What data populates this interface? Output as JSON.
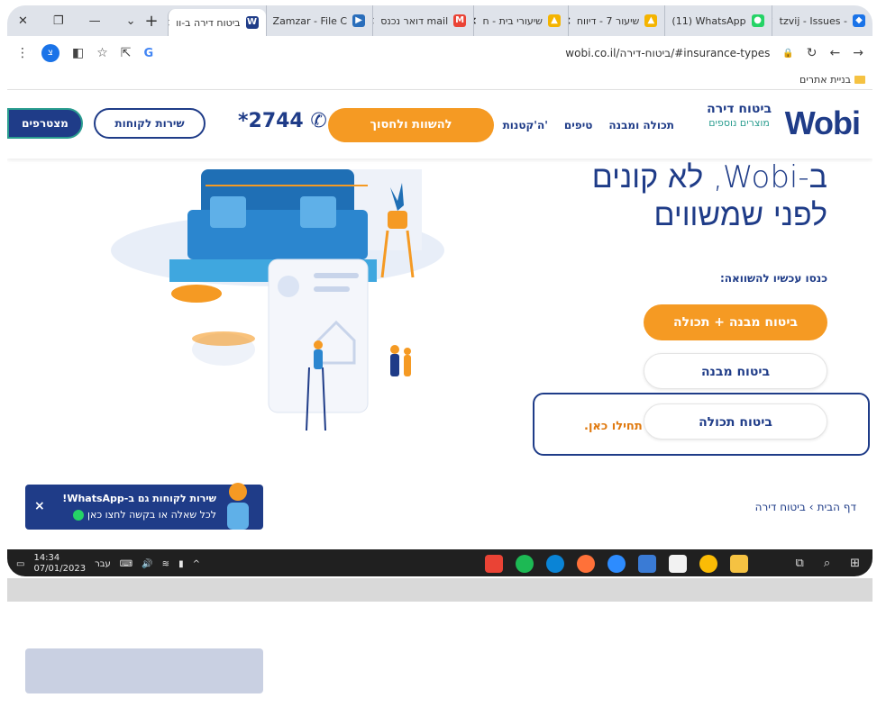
{
  "browser": {
    "tabs": [
      {
        "label": "tzvij - Issues -",
        "favicon_color": "#1a73e8"
      },
      {
        "label": "(11) WhatsApp",
        "favicon_color": "#25d366"
      },
      {
        "label": "שיעור 7 - דיווח",
        "favicon_color": "#f4b400"
      },
      {
        "label": "שיעורי בית - ח",
        "favicon_color": "#f4b400"
      },
      {
        "label": "דואר נכנס mail",
        "favicon_color": "#ea4335"
      },
      {
        "label": "Zamzar - File C",
        "favicon_color": "#2a6ebb"
      },
      {
        "label": "ביטוח דירה ב-וו",
        "favicon_color": "#1f3c88"
      }
    ],
    "url": "wobi.co.il/ביטוח-דירה/#insurance-types",
    "bookmark_folder": "בניית אתרים",
    "profile_badge": "צ"
  },
  "header": {
    "logo": "Wobi",
    "product_title": "ביטוח דירה",
    "product_sub": "מוצרים נוספים",
    "nav": [
      "תכולה ומבנה",
      "טיפים",
      "ה'קטנות'"
    ],
    "compare_cta": "להשוות ולחסוך",
    "phone": "*2744",
    "customer_service": "שירות לקוחות",
    "join": "מצטרפים"
  },
  "hero": {
    "title_line1": "ב-Wobi, לא קונים",
    "title_line2": "לפני שמשווים",
    "compare_label": "כנסו עכשיו להשוואה:",
    "option1": "ביטוח מבנה + תכולה",
    "option2": "ביטוח מבנה",
    "option3": "ביטוח תכולה",
    "start_here": "תחילו כאן."
  },
  "breadcrumb": {
    "home": "דף הבית",
    "separator": "›",
    "current": "ביטוח דירה"
  },
  "whatsapp_banner": {
    "title": "שירות לקוחות גם ב-WhatsApp!",
    "subtitle": "לכל שאלה או בקשה לחצו כאן",
    "close": "×"
  },
  "taskbar": {
    "time": "14:34",
    "date": "07/01/2023",
    "lang": "עבר"
  },
  "colors": {
    "brand_blue": "#1f3c88",
    "brand_orange": "#f59a23",
    "teal": "#2a9d8f"
  }
}
